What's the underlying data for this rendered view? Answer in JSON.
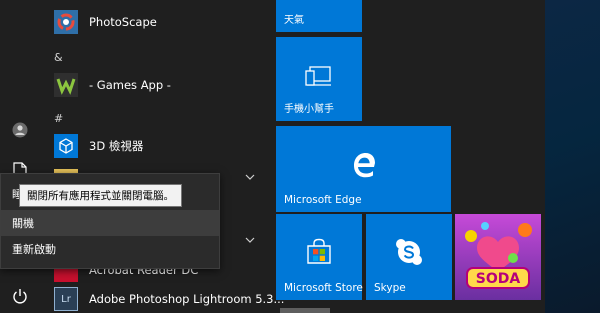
{
  "apps": [
    {
      "name": "PhotoScape",
      "icon": "photoscape-icon"
    },
    {
      "name": "- Games App -",
      "icon": "games-app-icon"
    },
    {
      "name": "3D 檢視器",
      "icon": "3d-viewer-icon"
    },
    {
      "name": "Acrobat Reader DC",
      "icon": "acrobat-icon"
    },
    {
      "name": "Adobe Photoshop Lightroom 5.3...",
      "icon": "lightroom-icon"
    }
  ],
  "groups": [
    "&",
    "#"
  ],
  "tiles": {
    "weather": "天氣",
    "phone": "手機小幫手",
    "edge": "Microsoft Edge",
    "store": "Microsoft Store",
    "skype": "Skype",
    "candy": "SODA"
  },
  "power_menu": {
    "tooltip": "關閉所有應用程式並關閉電腦。",
    "items": [
      "關機",
      "重新啟動"
    ]
  },
  "colors": {
    "tile_blue": "#0078d7",
    "menu_bg": "#1f1f1f"
  }
}
